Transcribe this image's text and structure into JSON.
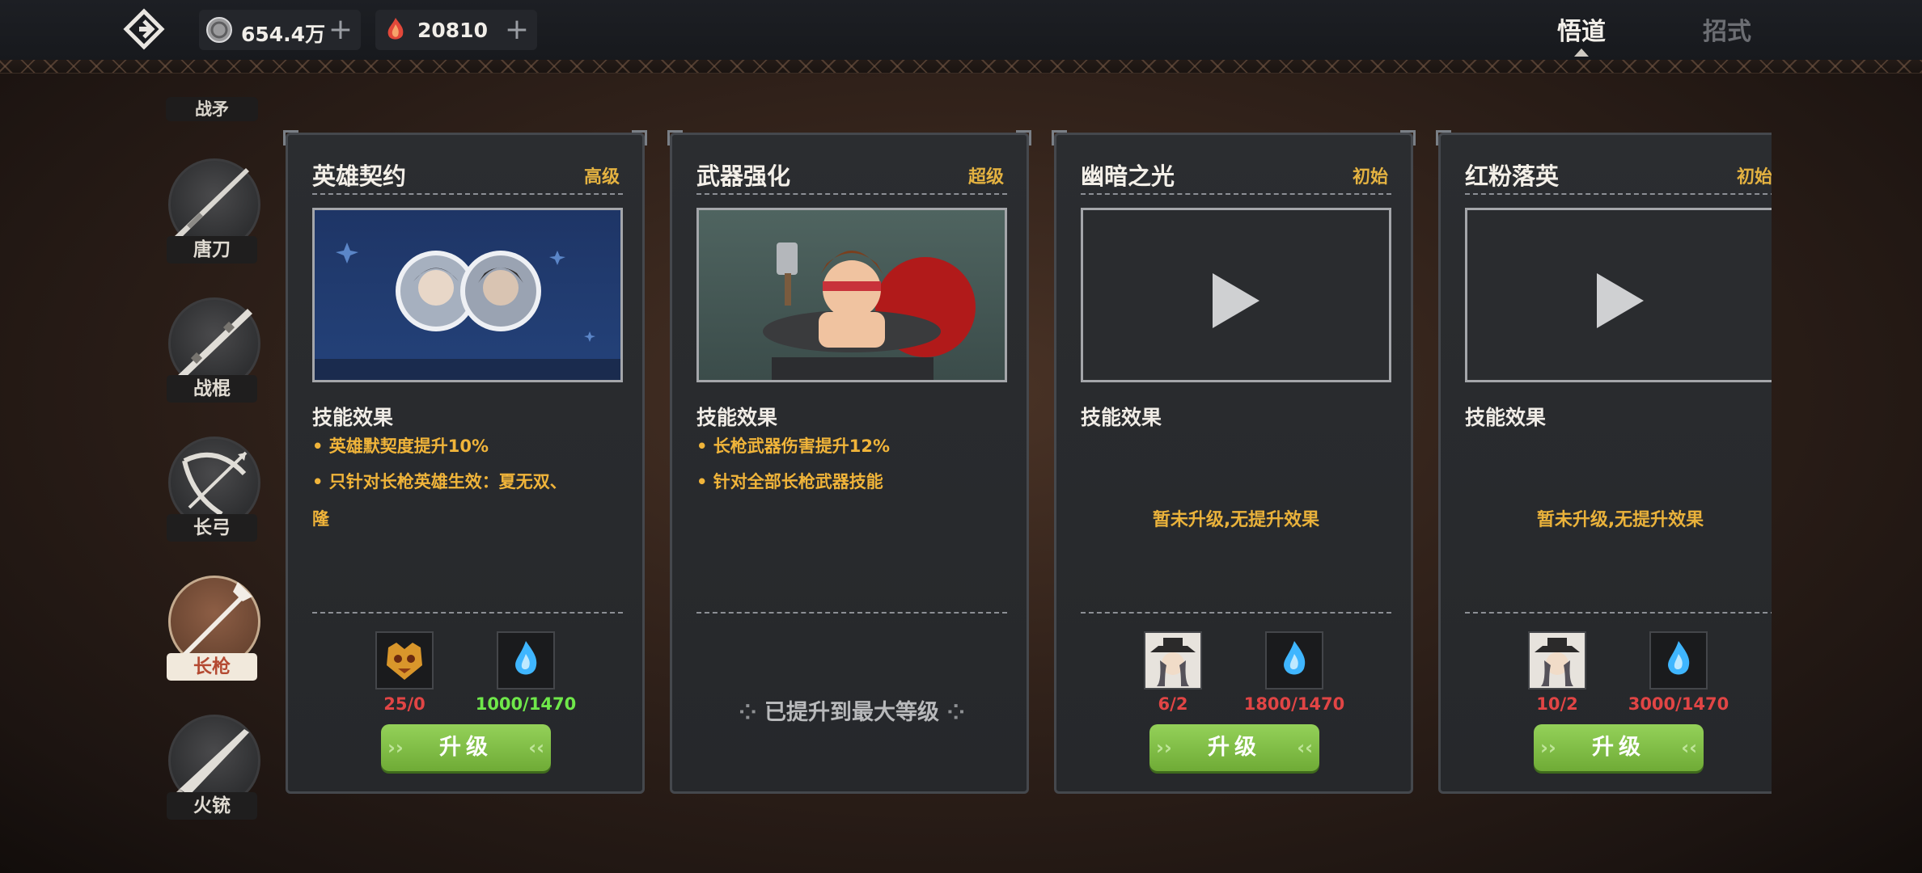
{
  "resources": {
    "coins": {
      "value": "654.4万",
      "icon": "silver-coin-icon"
    },
    "gems": {
      "value": "20810",
      "icon": "red-crystal-icon"
    }
  },
  "top_tabs": [
    {
      "label": "悟道",
      "active": true
    },
    {
      "label": "招式",
      "active": false
    }
  ],
  "weapon_section_label": "战矛",
  "weapons": [
    {
      "label": "唐刀",
      "icon": "dao-sword-icon",
      "active": false
    },
    {
      "label": "战棍",
      "icon": "staff-icon",
      "active": false
    },
    {
      "label": "长弓",
      "icon": "bow-icon",
      "active": false
    },
    {
      "label": "长枪",
      "icon": "spear-icon",
      "active": true
    },
    {
      "label": "火铳",
      "icon": "musket-icon",
      "active": false
    }
  ],
  "effect_heading": "技能效果",
  "upgrade_label": "升级",
  "cards": [
    {
      "title": "英雄契约",
      "tier": "高级",
      "effects": [
        "• 英雄默契度提升10%",
        "• 只针对长枪英雄生效：夏无双、",
        "隆"
      ],
      "costs": [
        {
          "icon": "golden-mask-icon",
          "value": "25/0",
          "color": "red"
        },
        {
          "icon": "blue-flame-icon",
          "value": "1000/1470",
          "color": "green"
        }
      ]
    },
    {
      "title": "武器强化",
      "tier": "超级",
      "effects": [
        "• 长枪武器伤害提升12%",
        "• 针对全部长枪武器技能"
      ],
      "maxed_text": "已提升到最大等级"
    },
    {
      "title": "幽暗之光",
      "tier": "初始",
      "no_effect": "暂未升级,无提升效果",
      "costs": [
        {
          "icon": "hero-portrait-icon",
          "value": "6/2",
          "color": "red"
        },
        {
          "icon": "blue-flame-icon",
          "value": "1800/1470",
          "color": "red"
        }
      ]
    },
    {
      "title": "红粉落英",
      "tier": "初始",
      "no_effect": "暂未升级,无提升效果",
      "costs": [
        {
          "icon": "hero-portrait-icon",
          "value": "10/2",
          "color": "red"
        },
        {
          "icon": "blue-flame-icon",
          "value": "3000/1470",
          "color": "red"
        }
      ]
    }
  ],
  "colors": {
    "tier_gold": "#e4b241",
    "effect_text": "#f0b43a",
    "cost_red": "#e14545",
    "cost_green": "#6fe84a",
    "upgrade_green": "#7fbf45"
  }
}
